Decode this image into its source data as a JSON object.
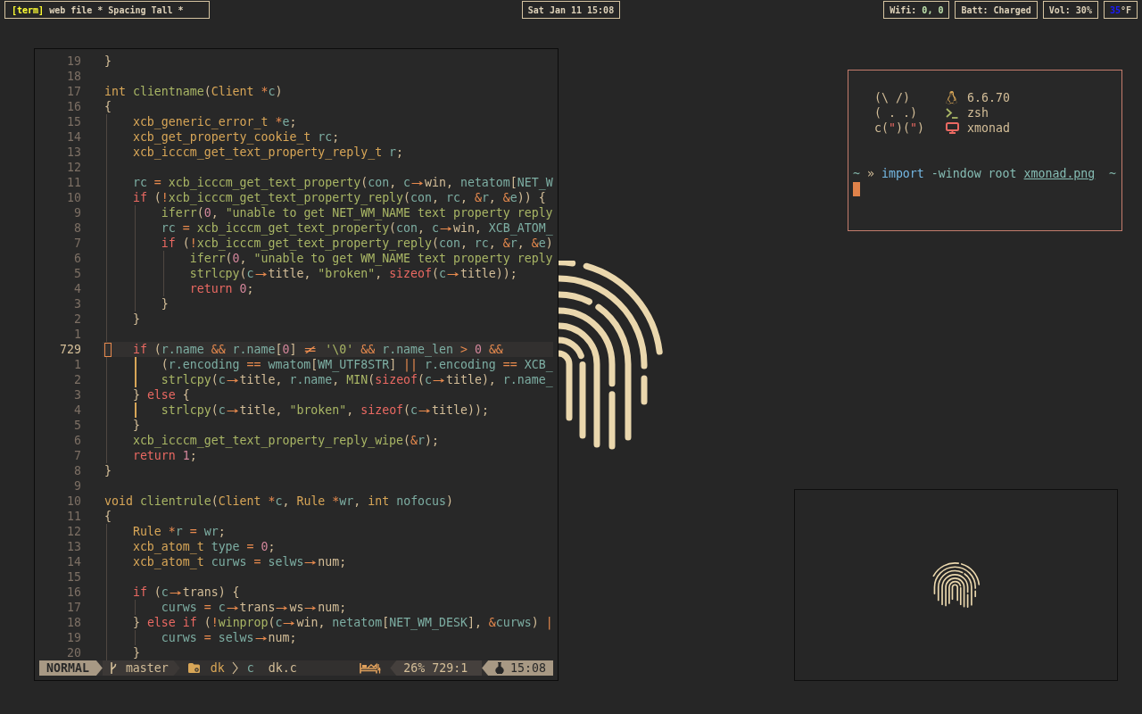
{
  "top_bar": {
    "workspace": {
      "tag": "[term]",
      "title": "web file * Spacing Tall *"
    },
    "clock": "Sat Jan 11 15:08",
    "indicators": [
      {
        "segments": [
          {
            "text": "Wifi: ",
            "kind": "label"
          },
          {
            "text": "0, 0",
            "kind": "good"
          }
        ]
      },
      {
        "segments": [
          {
            "text": "Batt: Charged",
            "kind": "label"
          }
        ]
      },
      {
        "segments": [
          {
            "text": "Vol: 30%",
            "kind": "label"
          }
        ]
      },
      {
        "segments": [
          {
            "text": "35",
            "kind": "cold"
          },
          {
            "text": "°F",
            "kind": "label"
          }
        ]
      }
    ]
  },
  "editor": {
    "lines": [
      {
        "number": "19",
        "current": false,
        "scope": false,
        "tokens": [
          {
            "kind": "plain",
            "text": "}"
          }
        ]
      },
      {
        "number": "18",
        "current": false,
        "scope": false
      },
      {
        "number": "17",
        "current": false,
        "scope": false,
        "tokens": [
          {
            "kind": "type",
            "text": "int "
          },
          {
            "kind": "function",
            "text": "clientname"
          },
          {
            "kind": "plain",
            "text": "("
          },
          {
            "kind": "type",
            "text": "Client "
          },
          {
            "kind": "operator",
            "text": "*"
          },
          {
            "kind": "variable",
            "text": "c"
          },
          {
            "kind": "plain",
            "text": ")"
          }
        ]
      },
      {
        "number": "16",
        "current": false,
        "scope": false,
        "tokens": [
          {
            "kind": "plain",
            "text": "{"
          }
        ]
      },
      {
        "number": "15",
        "current": false,
        "scope": false,
        "tokens": [
          {
            "kind": "type",
            "text": "    xcb_generic_error_t "
          },
          {
            "kind": "operator",
            "text": "*"
          },
          {
            "kind": "variable",
            "text": "e"
          },
          {
            "kind": "plain",
            "text": ";"
          }
        ]
      },
      {
        "number": "14",
        "current": false,
        "scope": false,
        "tokens": [
          {
            "kind": "type",
            "text": "    xcb_get_property_cookie_t "
          },
          {
            "kind": "variable",
            "text": "rc"
          },
          {
            "kind": "plain",
            "text": ";"
          }
        ]
      },
      {
        "number": "13",
        "current": false,
        "scope": false,
        "tokens": [
          {
            "kind": "type",
            "text": "    xcb_icccm_get_text_property_reply_t "
          },
          {
            "kind": "variable",
            "text": "r"
          },
          {
            "kind": "plain",
            "text": ";"
          }
        ]
      },
      {
        "number": "12",
        "current": false,
        "scope": false
      },
      {
        "number": "11",
        "current": false,
        "scope": false,
        "tokens": [
          {
            "kind": "variable",
            "text": "    rc "
          },
          {
            "kind": "operator",
            "text": "= "
          },
          {
            "kind": "function",
            "text": "xcb_icccm_get_text_property"
          },
          {
            "kind": "plain",
            "text": "("
          },
          {
            "kind": "variable",
            "text": "con"
          },
          {
            "kind": "plain",
            "text": ", "
          },
          {
            "kind": "variable",
            "text": "c"
          },
          {
            "kind": "ligature",
            "text": "→"
          },
          {
            "kind": "field",
            "text": "win"
          },
          {
            "kind": "plain",
            "text": ", "
          },
          {
            "kind": "variable",
            "text": "netatom"
          },
          {
            "kind": "plain",
            "text": "["
          },
          {
            "kind": "variable",
            "text": "NET_W"
          }
        ]
      },
      {
        "number": "10",
        "current": false,
        "scope": false,
        "tokens": [
          {
            "kind": "keyword",
            "text": "    if "
          },
          {
            "kind": "plain",
            "text": "("
          },
          {
            "kind": "operator",
            "text": "!"
          },
          {
            "kind": "function",
            "text": "xcb_icccm_get_text_property_reply"
          },
          {
            "kind": "plain",
            "text": "("
          },
          {
            "kind": "variable",
            "text": "con"
          },
          {
            "kind": "plain",
            "text": ", "
          },
          {
            "kind": "variable",
            "text": "rc"
          },
          {
            "kind": "plain",
            "text": ", "
          },
          {
            "kind": "operator",
            "text": "&"
          },
          {
            "kind": "variable",
            "text": "r"
          },
          {
            "kind": "plain",
            "text": ", "
          },
          {
            "kind": "operator",
            "text": "&"
          },
          {
            "kind": "variable",
            "text": "e"
          },
          {
            "kind": "plain",
            "text": ")) {"
          }
        ]
      },
      {
        "number": "9",
        "current": false,
        "scope": false,
        "tokens": [
          {
            "kind": "function",
            "text": "        iferr"
          },
          {
            "kind": "plain",
            "text": "("
          },
          {
            "kind": "number",
            "text": "0"
          },
          {
            "kind": "plain",
            "text": ", "
          },
          {
            "kind": "string",
            "text": "\"unable to get NET_WM_NAME text property reply"
          }
        ]
      },
      {
        "number": "8",
        "current": false,
        "scope": false,
        "tokens": [
          {
            "kind": "variable",
            "text": "        rc "
          },
          {
            "kind": "operator",
            "text": "= "
          },
          {
            "kind": "function",
            "text": "xcb_icccm_get_text_property"
          },
          {
            "kind": "plain",
            "text": "("
          },
          {
            "kind": "variable",
            "text": "con"
          },
          {
            "kind": "plain",
            "text": ", "
          },
          {
            "kind": "variable",
            "text": "c"
          },
          {
            "kind": "ligature",
            "text": "→"
          },
          {
            "kind": "field",
            "text": "win"
          },
          {
            "kind": "plain",
            "text": ", "
          },
          {
            "kind": "variable",
            "text": "XCB_ATOM_"
          }
        ]
      },
      {
        "number": "7",
        "current": false,
        "scope": false,
        "tokens": [
          {
            "kind": "keyword",
            "text": "        if "
          },
          {
            "kind": "plain",
            "text": "("
          },
          {
            "kind": "operator",
            "text": "!"
          },
          {
            "kind": "function",
            "text": "xcb_icccm_get_text_property_reply"
          },
          {
            "kind": "plain",
            "text": "("
          },
          {
            "kind": "variable",
            "text": "con"
          },
          {
            "kind": "plain",
            "text": ", "
          },
          {
            "kind": "variable",
            "text": "rc"
          },
          {
            "kind": "plain",
            "text": ", "
          },
          {
            "kind": "operator",
            "text": "&"
          },
          {
            "kind": "variable",
            "text": "r"
          },
          {
            "kind": "plain",
            "text": ", "
          },
          {
            "kind": "operator",
            "text": "&"
          },
          {
            "kind": "variable",
            "text": "e"
          },
          {
            "kind": "plain",
            "text": ")"
          }
        ]
      },
      {
        "number": "6",
        "current": false,
        "scope": false,
        "tokens": [
          {
            "kind": "function",
            "text": "            iferr"
          },
          {
            "kind": "plain",
            "text": "("
          },
          {
            "kind": "number",
            "text": "0"
          },
          {
            "kind": "plain",
            "text": ", "
          },
          {
            "kind": "string",
            "text": "\"unable to get WM_NAME text property reply"
          }
        ]
      },
      {
        "number": "5",
        "current": false,
        "scope": false,
        "tokens": [
          {
            "kind": "function",
            "text": "            strlcpy"
          },
          {
            "kind": "plain",
            "text": "("
          },
          {
            "kind": "variable",
            "text": "c"
          },
          {
            "kind": "ligature",
            "text": "→"
          },
          {
            "kind": "field",
            "text": "title"
          },
          {
            "kind": "plain",
            "text": ", "
          },
          {
            "kind": "string",
            "text": "\"broken\""
          },
          {
            "kind": "plain",
            "text": ", "
          },
          {
            "kind": "keyword",
            "text": "sizeof"
          },
          {
            "kind": "plain",
            "text": "("
          },
          {
            "kind": "variable",
            "text": "c"
          },
          {
            "kind": "ligature",
            "text": "→"
          },
          {
            "kind": "field",
            "text": "title"
          },
          {
            "kind": "plain",
            "text": "));"
          }
        ]
      },
      {
        "number": "4",
        "current": false,
        "scope": false,
        "tokens": [
          {
            "kind": "keyword",
            "text": "            return "
          },
          {
            "kind": "number",
            "text": "0"
          },
          {
            "kind": "plain",
            "text": ";"
          }
        ]
      },
      {
        "number": "3",
        "current": false,
        "scope": false,
        "tokens": [
          {
            "kind": "plain",
            "text": "        }"
          }
        ]
      },
      {
        "number": "2",
        "current": false,
        "scope": false,
        "tokens": [
          {
            "kind": "plain",
            "text": "    }"
          }
        ]
      },
      {
        "number": "1",
        "current": false,
        "scope": false
      },
      {
        "number": "729",
        "current": true,
        "scope": false,
        "tokens": [
          {
            "kind": "keyword",
            "text": "    if "
          },
          {
            "kind": "plain",
            "text": "("
          },
          {
            "kind": "variable",
            "text": "r.name "
          },
          {
            "kind": "operator",
            "text": "&& "
          },
          {
            "kind": "variable",
            "text": "r.name"
          },
          {
            "kind": "plain",
            "text": "["
          },
          {
            "kind": "number",
            "text": "0"
          },
          {
            "kind": "plain",
            "text": "] "
          },
          {
            "kind": "ligature",
            "text": "≠"
          },
          {
            "kind": "string",
            "text": " '\\0' "
          },
          {
            "kind": "operator",
            "text": "&& "
          },
          {
            "kind": "variable",
            "text": "r.name_len "
          },
          {
            "kind": "operator",
            "text": "> "
          },
          {
            "kind": "number",
            "text": "0 "
          },
          {
            "kind": "operator",
            "text": "&&"
          }
        ]
      },
      {
        "number": "1",
        "current": false,
        "scope": true,
        "tokens": [
          {
            "kind": "plain",
            "text": "        ("
          },
          {
            "kind": "variable",
            "text": "r.encoding "
          },
          {
            "kind": "operator",
            "text": "== "
          },
          {
            "kind": "variable",
            "text": "wmatom"
          },
          {
            "kind": "plain",
            "text": "["
          },
          {
            "kind": "variable",
            "text": "WM_UTF8STR"
          },
          {
            "kind": "plain",
            "text": "] "
          },
          {
            "kind": "operator",
            "text": "|| "
          },
          {
            "kind": "variable",
            "text": "r.encoding "
          },
          {
            "kind": "operator",
            "text": "== "
          },
          {
            "kind": "variable",
            "text": "XCB_"
          }
        ]
      },
      {
        "number": "2",
        "current": false,
        "scope": true,
        "tokens": [
          {
            "kind": "function",
            "text": "        strlcpy"
          },
          {
            "kind": "plain",
            "text": "("
          },
          {
            "kind": "variable",
            "text": "c"
          },
          {
            "kind": "ligature",
            "text": "→"
          },
          {
            "kind": "field",
            "text": "title"
          },
          {
            "kind": "plain",
            "text": ", "
          },
          {
            "kind": "variable",
            "text": "r.name"
          },
          {
            "kind": "plain",
            "text": ", "
          },
          {
            "kind": "function",
            "text": "MIN"
          },
          {
            "kind": "plain",
            "text": "("
          },
          {
            "kind": "keyword",
            "text": "sizeof"
          },
          {
            "kind": "plain",
            "text": "("
          },
          {
            "kind": "variable",
            "text": "c"
          },
          {
            "kind": "ligature",
            "text": "→"
          },
          {
            "kind": "field",
            "text": "title"
          },
          {
            "kind": "plain",
            "text": "), "
          },
          {
            "kind": "variable",
            "text": "r.name_"
          }
        ]
      },
      {
        "number": "3",
        "current": false,
        "scope": false,
        "tokens": [
          {
            "kind": "plain",
            "text": "    } "
          },
          {
            "kind": "keyword",
            "text": "else "
          },
          {
            "kind": "plain",
            "text": "{"
          }
        ]
      },
      {
        "number": "4",
        "current": false,
        "scope": true,
        "tokens": [
          {
            "kind": "function",
            "text": "        strlcpy"
          },
          {
            "kind": "plain",
            "text": "("
          },
          {
            "kind": "variable",
            "text": "c"
          },
          {
            "kind": "ligature",
            "text": "→"
          },
          {
            "kind": "field",
            "text": "title"
          },
          {
            "kind": "plain",
            "text": ", "
          },
          {
            "kind": "string",
            "text": "\"broken\""
          },
          {
            "kind": "plain",
            "text": ", "
          },
          {
            "kind": "keyword",
            "text": "sizeof"
          },
          {
            "kind": "plain",
            "text": "("
          },
          {
            "kind": "variable",
            "text": "c"
          },
          {
            "kind": "ligature",
            "text": "→"
          },
          {
            "kind": "field",
            "text": "title"
          },
          {
            "kind": "plain",
            "text": "));"
          }
        ]
      },
      {
        "number": "5",
        "current": false,
        "scope": false,
        "tokens": [
          {
            "kind": "plain",
            "text": "    }"
          }
        ]
      },
      {
        "number": "6",
        "current": false,
        "scope": false,
        "tokens": [
          {
            "kind": "function",
            "text": "    xcb_icccm_get_text_property_reply_wipe"
          },
          {
            "kind": "plain",
            "text": "("
          },
          {
            "kind": "operator",
            "text": "&"
          },
          {
            "kind": "variable",
            "text": "r"
          },
          {
            "kind": "plain",
            "text": ");"
          }
        ]
      },
      {
        "number": "7",
        "current": false,
        "scope": false,
        "tokens": [
          {
            "kind": "keyword",
            "text": "    return "
          },
          {
            "kind": "number",
            "text": "1"
          },
          {
            "kind": "plain",
            "text": ";"
          }
        ]
      },
      {
        "number": "8",
        "current": false,
        "scope": false,
        "tokens": [
          {
            "kind": "plain",
            "text": "}"
          }
        ]
      },
      {
        "number": "9",
        "current": false,
        "scope": false
      },
      {
        "number": "10",
        "current": false,
        "scope": false,
        "tokens": [
          {
            "kind": "type",
            "text": "void "
          },
          {
            "kind": "function",
            "text": "clientrule"
          },
          {
            "kind": "plain",
            "text": "("
          },
          {
            "kind": "type",
            "text": "Client "
          },
          {
            "kind": "operator",
            "text": "*"
          },
          {
            "kind": "variable",
            "text": "c"
          },
          {
            "kind": "plain",
            "text": ", "
          },
          {
            "kind": "type",
            "text": "Rule "
          },
          {
            "kind": "operator",
            "text": "*"
          },
          {
            "kind": "variable",
            "text": "wr"
          },
          {
            "kind": "plain",
            "text": ", "
          },
          {
            "kind": "type",
            "text": "int "
          },
          {
            "kind": "variable",
            "text": "nofocus"
          },
          {
            "kind": "plain",
            "text": ")"
          }
        ]
      },
      {
        "number": "11",
        "current": false,
        "scope": false,
        "tokens": [
          {
            "kind": "plain",
            "text": "{"
          }
        ]
      },
      {
        "number": "12",
        "current": false,
        "scope": false,
        "tokens": [
          {
            "kind": "type",
            "text": "    Rule "
          },
          {
            "kind": "operator",
            "text": "*"
          },
          {
            "kind": "variable",
            "text": "r "
          },
          {
            "kind": "operator",
            "text": "= "
          },
          {
            "kind": "variable",
            "text": "wr"
          },
          {
            "kind": "plain",
            "text": ";"
          }
        ]
      },
      {
        "number": "13",
        "current": false,
        "scope": false,
        "tokens": [
          {
            "kind": "type",
            "text": "    xcb_atom_t "
          },
          {
            "kind": "variable",
            "text": "type "
          },
          {
            "kind": "operator",
            "text": "= "
          },
          {
            "kind": "number",
            "text": "0"
          },
          {
            "kind": "plain",
            "text": ";"
          }
        ]
      },
      {
        "number": "14",
        "current": false,
        "scope": false,
        "tokens": [
          {
            "kind": "type",
            "text": "    xcb_atom_t "
          },
          {
            "kind": "variable",
            "text": "curws "
          },
          {
            "kind": "operator",
            "text": "= "
          },
          {
            "kind": "variable",
            "text": "selws"
          },
          {
            "kind": "ligature",
            "text": "→"
          },
          {
            "kind": "field",
            "text": "num"
          },
          {
            "kind": "plain",
            "text": ";"
          }
        ]
      },
      {
        "number": "15",
        "current": false,
        "scope": false
      },
      {
        "number": "16",
        "current": false,
        "scope": false,
        "tokens": [
          {
            "kind": "keyword",
            "text": "    if "
          },
          {
            "kind": "plain",
            "text": "("
          },
          {
            "kind": "variable",
            "text": "c"
          },
          {
            "kind": "ligature",
            "text": "→"
          },
          {
            "kind": "field",
            "text": "trans"
          },
          {
            "kind": "plain",
            "text": ") {"
          }
        ]
      },
      {
        "number": "17",
        "current": false,
        "scope": false,
        "tokens": [
          {
            "kind": "variable",
            "text": "        curws "
          },
          {
            "kind": "operator",
            "text": "= "
          },
          {
            "kind": "variable",
            "text": "c"
          },
          {
            "kind": "ligature",
            "text": "→"
          },
          {
            "kind": "field",
            "text": "trans"
          },
          {
            "kind": "ligature",
            "text": "→"
          },
          {
            "kind": "field",
            "text": "ws"
          },
          {
            "kind": "ligature",
            "text": "→"
          },
          {
            "kind": "field",
            "text": "num"
          },
          {
            "kind": "plain",
            "text": ";"
          }
        ]
      },
      {
        "number": "18",
        "current": false,
        "scope": false,
        "tokens": [
          {
            "kind": "plain",
            "text": "    } "
          },
          {
            "kind": "keyword",
            "text": "else if "
          },
          {
            "kind": "plain",
            "text": "("
          },
          {
            "kind": "operator",
            "text": "!"
          },
          {
            "kind": "function",
            "text": "winprop"
          },
          {
            "kind": "plain",
            "text": "("
          },
          {
            "kind": "variable",
            "text": "c"
          },
          {
            "kind": "ligature",
            "text": "→"
          },
          {
            "kind": "field",
            "text": "win"
          },
          {
            "kind": "plain",
            "text": ", "
          },
          {
            "kind": "variable",
            "text": "netatom"
          },
          {
            "kind": "plain",
            "text": "["
          },
          {
            "kind": "variable",
            "text": "NET_WM_DESK"
          },
          {
            "kind": "plain",
            "text": "], "
          },
          {
            "kind": "operator",
            "text": "&"
          },
          {
            "kind": "variable",
            "text": "curws"
          },
          {
            "kind": "plain",
            "text": ") "
          },
          {
            "kind": "operator",
            "text": "|"
          }
        ]
      },
      {
        "number": "19",
        "current": false,
        "scope": false,
        "tokens": [
          {
            "kind": "variable",
            "text": "        curws "
          },
          {
            "kind": "operator",
            "text": "= "
          },
          {
            "kind": "variable",
            "text": "selws"
          },
          {
            "kind": "ligature",
            "text": "→"
          },
          {
            "kind": "field",
            "text": "num"
          },
          {
            "kind": "plain",
            "text": ";"
          }
        ]
      },
      {
        "number": "20",
        "current": false,
        "scope": false,
        "tokens": [
          {
            "kind": "plain",
            "text": "    }"
          }
        ]
      }
    ],
    "status_line": {
      "mode": "NORMAL",
      "branch": "master",
      "directory": "dk",
      "file_icon": "c",
      "file": "dk.c",
      "progress": "26%",
      "position": "729:1",
      "time": "15:08"
    }
  },
  "terminal": {
    "art": [
      {
        "segments": [
          {
            "text": "(\\ /)",
            "kind": "text"
          }
        ]
      },
      {
        "segments": [
          {
            "text": "( . .)",
            "kind": "text"
          }
        ]
      },
      {
        "segments": [
          {
            "text": "c(",
            "kind": "text"
          },
          {
            "text": "\"",
            "kind": "accent"
          },
          {
            "text": ")(",
            "kind": "text"
          },
          {
            "text": "\"",
            "kind": "accent"
          },
          {
            "text": ")",
            "kind": "text"
          }
        ]
      }
    ],
    "info": [
      {
        "kind": "kernel",
        "value": "6.6.70"
      },
      {
        "kind": "shell",
        "value": "zsh"
      },
      {
        "kind": "window_manager",
        "value": "xmonad"
      }
    ],
    "prompt": {
      "cwd": "~",
      "symbol": "»",
      "command": "import",
      "arguments": "-window root",
      "file": "xmonad.png",
      "right_cwd": "~"
    }
  }
}
